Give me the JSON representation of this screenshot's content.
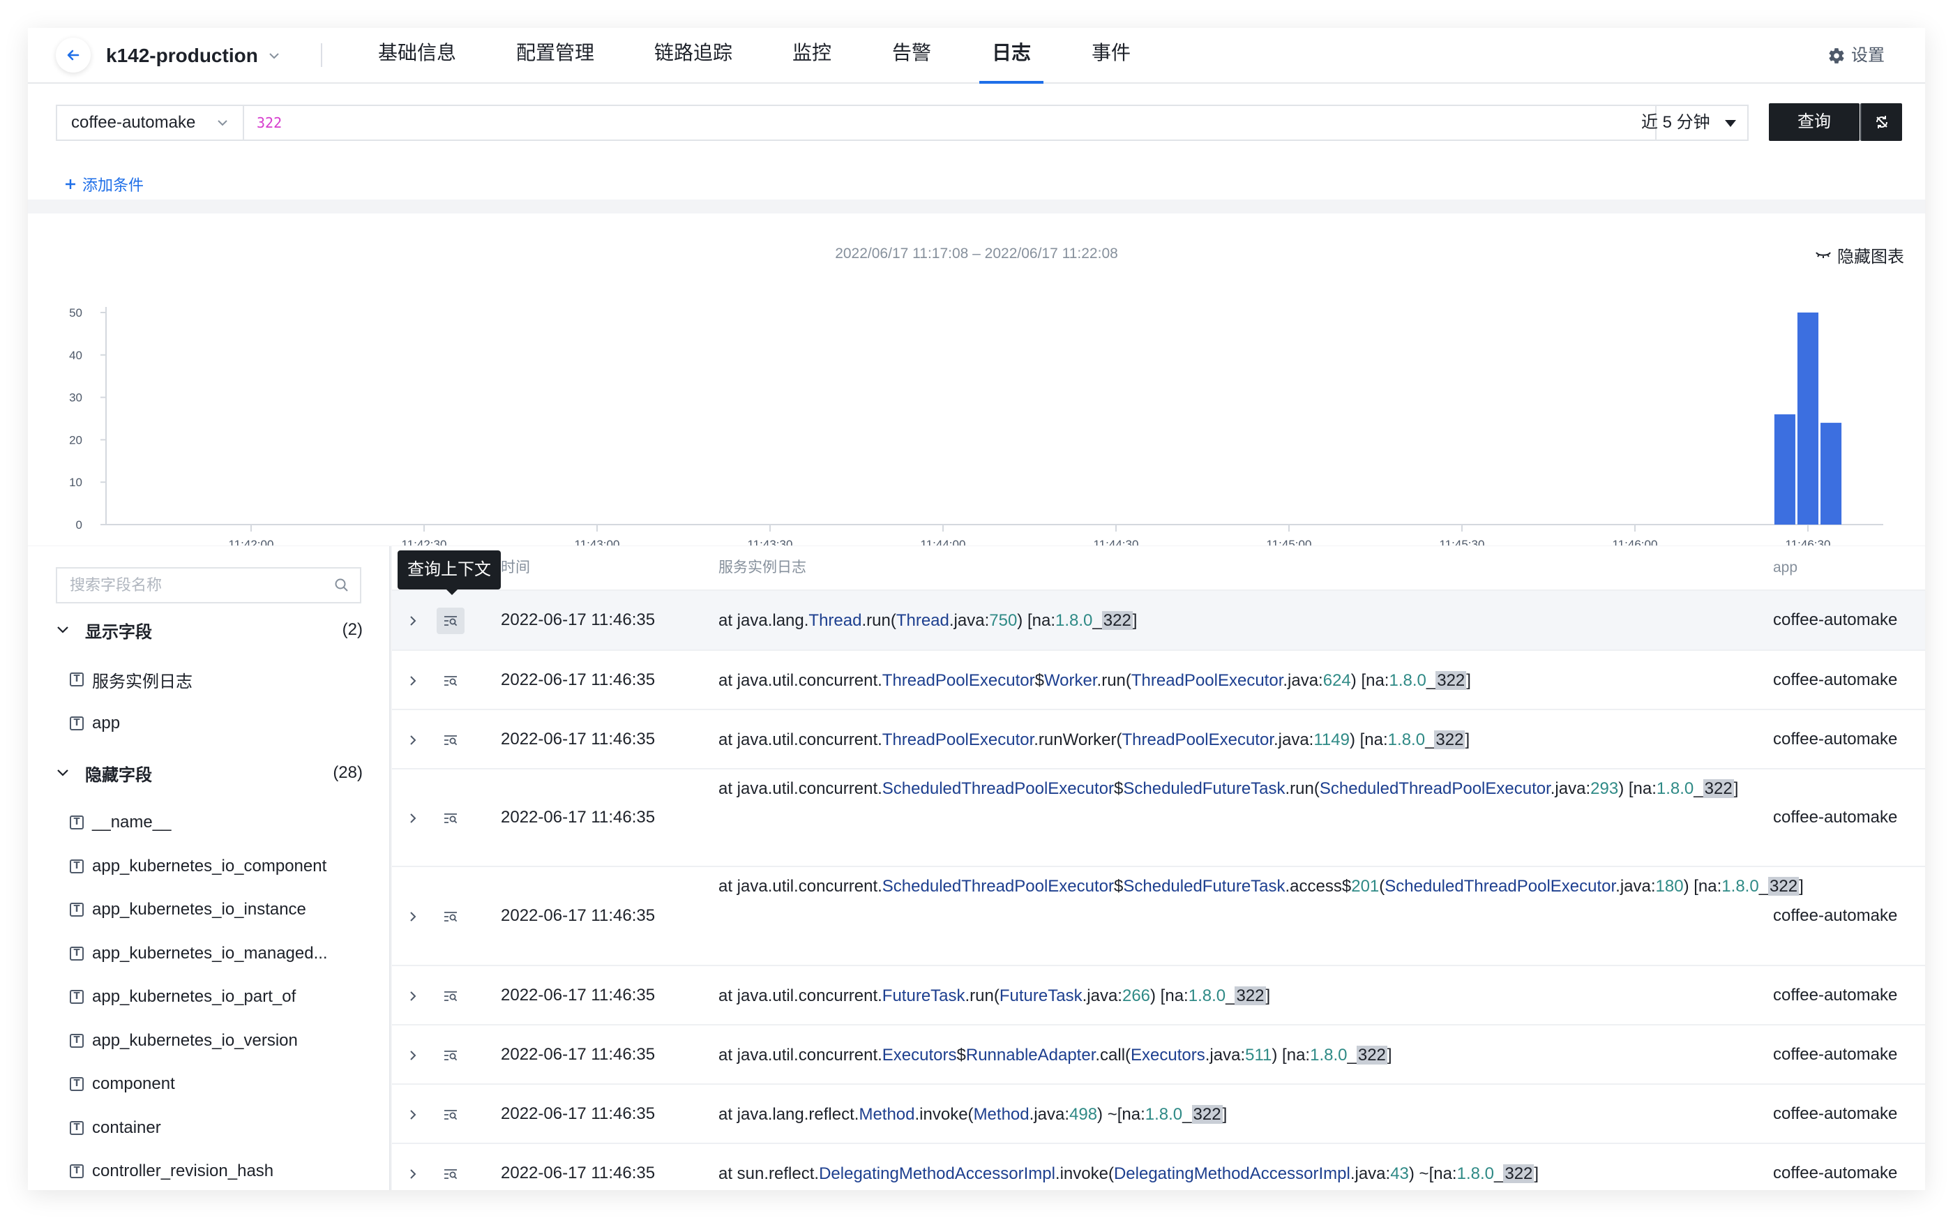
{
  "header": {
    "app_name": "k142-production",
    "tabs": [
      {
        "label": "基础信息"
      },
      {
        "label": "配置管理"
      },
      {
        "label": "链路追踪"
      },
      {
        "label": "监控"
      },
      {
        "label": "告警"
      },
      {
        "label": "日志",
        "active": true
      },
      {
        "label": "事件"
      }
    ],
    "settings_label": "设置"
  },
  "query": {
    "service": "coffee-automake",
    "query_text": "322",
    "time_range": "近 5 分钟",
    "query_button": "查询",
    "add_condition": "添加条件"
  },
  "chart_data": {
    "type": "bar",
    "title": "2022/06/17 11:17:08 – 2022/06/17 11:22:08",
    "hide_label": "隐藏图表",
    "x_ticks": [
      "11:42:00",
      "11:42:30",
      "11:43:00",
      "11:43:30",
      "11:44:00",
      "11:44:30",
      "11:45:00",
      "11:45:30",
      "11:46:00",
      "11:46:30"
    ],
    "y_ticks": [
      0,
      10,
      20,
      30,
      40,
      50
    ],
    "ylim": [
      0,
      50
    ],
    "bars": [
      {
        "x": "11:46:26",
        "value": 26
      },
      {
        "x": "11:46:30",
        "value": 50
      },
      {
        "x": "11:46:34",
        "value": 24
      }
    ],
    "bar_color": "#3c6fe0"
  },
  "fields": {
    "search_placeholder": "搜索字段名称",
    "shown_label": "显示字段",
    "shown_count": "(2)",
    "shown": [
      "服务实例日志",
      "app"
    ],
    "hidden_label": "隐藏字段",
    "hidden_count": "(28)",
    "hidden": [
      "__name__",
      "app_kubernetes_io_component",
      "app_kubernetes_io_instance",
      "app_kubernetes_io_managed...",
      "app_kubernetes_io_part_of",
      "app_kubernetes_io_version",
      "component",
      "container",
      "controller_revision_hash"
    ]
  },
  "table": {
    "col_time": "时间",
    "col_log": "服务实例日志",
    "col_app": "app",
    "tooltip": "查询上下文",
    "rows": [
      {
        "time": "2022-06-17 11:46:35",
        "app": "coffee-automake",
        "msg": [
          [
            "t",
            "at java.lang."
          ],
          [
            "c",
            "Thread"
          ],
          [
            "t",
            ".run("
          ],
          [
            "c",
            "Thread"
          ],
          [
            "t",
            ".java:"
          ],
          [
            "n",
            "750"
          ],
          [
            "t",
            ") [na:"
          ],
          [
            "n",
            "1.8.0"
          ],
          [
            "t",
            "_"
          ],
          [
            "h",
            "322"
          ],
          [
            "t",
            "]"
          ]
        ]
      },
      {
        "time": "2022-06-17 11:46:35",
        "app": "coffee-automake",
        "msg": [
          [
            "t",
            "at java.util.concurrent."
          ],
          [
            "c",
            "ThreadPoolExecutor"
          ],
          [
            "t",
            "$"
          ],
          [
            "c",
            "Worker"
          ],
          [
            "t",
            ".run("
          ],
          [
            "c",
            "ThreadPoolExecutor"
          ],
          [
            "t",
            ".java:"
          ],
          [
            "n",
            "624"
          ],
          [
            "t",
            ") [na:"
          ],
          [
            "n",
            "1.8.0"
          ],
          [
            "t",
            "_"
          ],
          [
            "h",
            "322"
          ],
          [
            "t",
            "]"
          ]
        ]
      },
      {
        "time": "2022-06-17 11:46:35",
        "app": "coffee-automake",
        "msg": [
          [
            "t",
            "at java.util.concurrent."
          ],
          [
            "c",
            "ThreadPoolExecutor"
          ],
          [
            "t",
            ".runWorker("
          ],
          [
            "c",
            "ThreadPoolExecutor"
          ],
          [
            "t",
            ".java:"
          ],
          [
            "n",
            "1149"
          ],
          [
            "t",
            ") [na:"
          ],
          [
            "n",
            "1.8.0"
          ],
          [
            "t",
            "_"
          ],
          [
            "h",
            "322"
          ],
          [
            "t",
            "]"
          ]
        ]
      },
      {
        "time": "2022-06-17 11:46:35",
        "app": "coffee-automake",
        "msg": [
          [
            "t",
            "at java.util.concurrent."
          ],
          [
            "c",
            "ScheduledThreadPoolExecutor"
          ],
          [
            "t",
            "$"
          ],
          [
            "c",
            "ScheduledFutureTask"
          ],
          [
            "t",
            ".run("
          ],
          [
            "c",
            "ScheduledThreadPoolExecutor"
          ],
          [
            "t",
            ".java:"
          ],
          [
            "n",
            "293"
          ],
          [
            "t",
            ") [na:"
          ],
          [
            "n",
            "1.8.0"
          ],
          [
            "t",
            "_"
          ],
          [
            "h",
            "322"
          ],
          [
            "t",
            "]"
          ]
        ]
      },
      {
        "time": "2022-06-17 11:46:35",
        "app": "coffee-automake",
        "msg": [
          [
            "t",
            "at java.util.concurrent."
          ],
          [
            "c",
            "ScheduledThreadPoolExecutor"
          ],
          [
            "t",
            "$"
          ],
          [
            "c",
            "ScheduledFutureTask"
          ],
          [
            "t",
            ".access$"
          ],
          [
            "n",
            "201"
          ],
          [
            "t",
            "("
          ],
          [
            "c",
            "ScheduledThreadPoolExecutor"
          ],
          [
            "t",
            ".java:"
          ],
          [
            "n",
            "180"
          ],
          [
            "t",
            ") [na:"
          ],
          [
            "n",
            "1.8.0"
          ],
          [
            "t",
            "_"
          ],
          [
            "h",
            "322"
          ],
          [
            "t",
            "]"
          ]
        ]
      },
      {
        "time": "2022-06-17 11:46:35",
        "app": "coffee-automake",
        "msg": [
          [
            "t",
            "at java.util.concurrent."
          ],
          [
            "c",
            "FutureTask"
          ],
          [
            "t",
            ".run("
          ],
          [
            "c",
            "FutureTask"
          ],
          [
            "t",
            ".java:"
          ],
          [
            "n",
            "266"
          ],
          [
            "t",
            ") [na:"
          ],
          [
            "n",
            "1.8.0"
          ],
          [
            "t",
            "_"
          ],
          [
            "h",
            "322"
          ],
          [
            "t",
            "]"
          ]
        ]
      },
      {
        "time": "2022-06-17 11:46:35",
        "app": "coffee-automake",
        "msg": [
          [
            "t",
            "at java.util.concurrent."
          ],
          [
            "c",
            "Executors"
          ],
          [
            "t",
            "$"
          ],
          [
            "c",
            "RunnableAdapter"
          ],
          [
            "t",
            ".call("
          ],
          [
            "c",
            "Executors"
          ],
          [
            "t",
            ".java:"
          ],
          [
            "n",
            "511"
          ],
          [
            "t",
            ") [na:"
          ],
          [
            "n",
            "1.8.0"
          ],
          [
            "t",
            "_"
          ],
          [
            "h",
            "322"
          ],
          [
            "t",
            "]"
          ]
        ]
      },
      {
        "time": "2022-06-17 11:46:35",
        "app": "coffee-automake",
        "msg": [
          [
            "t",
            "at java.lang.reflect."
          ],
          [
            "c",
            "Method"
          ],
          [
            "t",
            ".invoke("
          ],
          [
            "c",
            "Method"
          ],
          [
            "t",
            ".java:"
          ],
          [
            "n",
            "498"
          ],
          [
            "t",
            ") ~[na:"
          ],
          [
            "n",
            "1.8.0"
          ],
          [
            "t",
            "_"
          ],
          [
            "h",
            "322"
          ],
          [
            "t",
            "]"
          ]
        ]
      },
      {
        "time": "2022-06-17 11:46:35",
        "app": "coffee-automake",
        "msg": [
          [
            "t",
            "at sun.reflect."
          ],
          [
            "c",
            "DelegatingMethodAccessorImpl"
          ],
          [
            "t",
            ".invoke("
          ],
          [
            "c",
            "DelegatingMethodAccessorImpl"
          ],
          [
            "t",
            ".java:"
          ],
          [
            "n",
            "43"
          ],
          [
            "t",
            ") ~[na:"
          ],
          [
            "n",
            "1.8.0"
          ],
          [
            "t",
            "_"
          ],
          [
            "h",
            "322"
          ],
          [
            "t",
            "]"
          ]
        ]
      }
    ]
  }
}
